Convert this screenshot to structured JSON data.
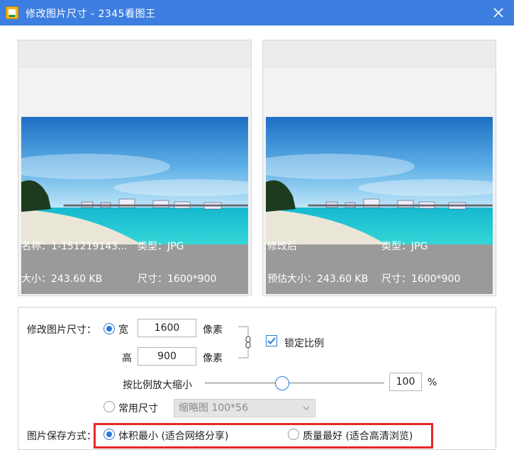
{
  "window": {
    "title": "修改图片尺寸 - 2345看图王",
    "icons": {
      "app": "app-logo-icon",
      "close": "close-icon"
    }
  },
  "preview_original": {
    "name_label": "名称：1-151219143...",
    "type_label": "类型：JPG",
    "size_label": "大小：243.60 KB",
    "dim_label": "尺寸：1600*900"
  },
  "preview_modified": {
    "name_label": "修改后",
    "type_label": "类型：JPG",
    "size_label": "预估大小：243.60 KB",
    "dim_label": "尺寸：1600*900"
  },
  "resize": {
    "section_label": "修改图片尺寸：",
    "width_label": "宽",
    "width_value": "1600",
    "width_unit": "像素",
    "height_label": "高",
    "height_value": "900",
    "height_unit": "像素",
    "lock_label": "锁定比例",
    "lock_checked": true,
    "scale_label": "按比例放大缩小",
    "scale_value": "100",
    "scale_unit": "%",
    "scale_fraction": 0.4,
    "common_label": "常用尺寸",
    "common_selected": "缩略图 100*56",
    "custom_size_selected": true
  },
  "save_mode": {
    "label": "图片保存方式：",
    "option_small": "体积最小 (适合网络分享)",
    "option_quality": "质量最好 (适合高清浏览)",
    "selected": "small"
  },
  "colors": {
    "titlebar": "#3d7fe0",
    "accent": "#2b79d8",
    "highlight_border": "#e8262b",
    "info_bar": "#9a9a9a"
  }
}
